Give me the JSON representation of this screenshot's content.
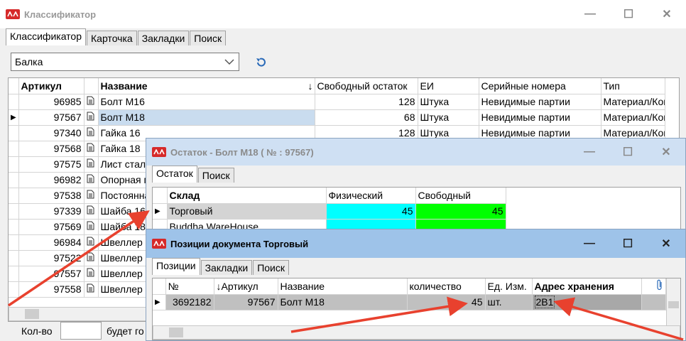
{
  "colors": {
    "accent": "#d62a2a",
    "title_inactive": "#ffffff",
    "title_mid": "#cfe0f3",
    "title_active": "#9ec3e9",
    "cyan": "#00ffff",
    "green": "#00ff00",
    "selected_row": "#c9dcef"
  },
  "main": {
    "title": "Классификатор",
    "tabs": [
      "Классификатор",
      "Карточка",
      "Закладки",
      "Поиск"
    ],
    "combo_value": "Балка",
    "columns": [
      "Артикул",
      "Название",
      "Свободный остаток",
      "ЕИ",
      "Серийные номера",
      "Тип"
    ],
    "rows": [
      {
        "art": "96985",
        "name": "Болт М16",
        "free": "128",
        "unit": "Штука",
        "serial": "Невидимые партии",
        "type": "Материал/Ком"
      },
      {
        "art": "97567",
        "name": "Болт М18",
        "free": "68",
        "unit": "Штука",
        "serial": "Невидимые партии",
        "type": "Материал/Ком"
      },
      {
        "art": "97340",
        "name": "Гайка 16",
        "free": "128",
        "unit": "Штука",
        "serial": "Невидимые партии",
        "type": "Материал/Ком"
      },
      {
        "art": "97568",
        "name": "Гайка 18"
      },
      {
        "art": "97575",
        "name": "Лист сталь"
      },
      {
        "art": "96982",
        "name": "Опорная пл"
      },
      {
        "art": "97538",
        "name": "Постоянная"
      },
      {
        "art": "97339",
        "name": "Шайба  16"
      },
      {
        "art": "97569",
        "name": "Шайба  18"
      },
      {
        "art": "96984",
        "name": "Швеллер №"
      },
      {
        "art": "97522",
        "name": "Швеллер №"
      },
      {
        "art": "97557",
        "name": "Швеллер №"
      },
      {
        "art": "97558",
        "name": "Швеллер №"
      }
    ],
    "qty_label": "Кол-во",
    "footer_text": "будет го"
  },
  "stock": {
    "title": "Остаток - Болт М18 ( № : 97567)",
    "tabs": [
      "Остаток",
      "Поиск"
    ],
    "columns": [
      "Склад",
      "Физический",
      "Свободный"
    ],
    "rows": [
      {
        "wh": "Торговый",
        "phys": "45",
        "free": "45"
      },
      {
        "wh": "Buddha WareHouse",
        "phys": "",
        "free": ""
      }
    ]
  },
  "doc": {
    "title": "Позиции документа Торговый",
    "tabs": [
      "Позиции",
      "Закладки",
      "Поиск"
    ],
    "columns": [
      "№",
      "Артикул",
      "Название",
      "количество",
      "Ед. Изм.",
      "Адрес хранения"
    ],
    "row": {
      "num": "3692182",
      "art": "97567",
      "name": "Болт М18",
      "qty": "45",
      "unit": "шт.",
      "addr": "2B1"
    }
  },
  "icons": {
    "close": "✕",
    "maximize": "☐",
    "minimize": "—",
    "sort": "↓",
    "attach": "📎"
  }
}
